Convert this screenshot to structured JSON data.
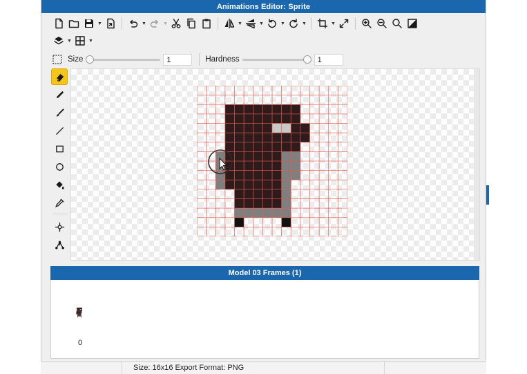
{
  "window": {
    "title": "Animations Editor: Sprite"
  },
  "toolbar": {
    "row1": [
      {
        "name": "new-file-icon",
        "arrow": false
      },
      {
        "name": "open-folder-icon",
        "arrow": false
      },
      {
        "name": "save-icon",
        "arrow": true
      },
      {
        "name": "export-icon",
        "arrow": false
      },
      {
        "sep": true
      },
      {
        "name": "undo-icon",
        "arrow": true
      },
      {
        "name": "redo-icon",
        "arrow": true,
        "disabled": true
      },
      {
        "name": "cut-icon",
        "arrow": false
      },
      {
        "name": "copy-icon",
        "arrow": false
      },
      {
        "name": "paste-icon",
        "arrow": false
      },
      {
        "sep": true
      },
      {
        "name": "flip-horizontal-icon",
        "arrow": true
      },
      {
        "name": "flip-vertical-icon",
        "arrow": true
      },
      {
        "name": "rotate-left-icon",
        "arrow": true
      },
      {
        "name": "rotate-right-icon",
        "arrow": true
      },
      {
        "sep": true
      },
      {
        "name": "crop-icon",
        "arrow": true
      },
      {
        "name": "resize-icon",
        "arrow": false
      },
      {
        "sep": true
      },
      {
        "name": "zoom-in-icon",
        "arrow": false
      },
      {
        "name": "zoom-out-icon",
        "arrow": false
      },
      {
        "name": "zoom-fit-icon",
        "arrow": false
      },
      {
        "name": "color-swap-icon",
        "arrow": false
      }
    ],
    "row2": [
      {
        "name": "layers-icon",
        "arrow": true
      },
      {
        "name": "grid-icon",
        "arrow": true
      }
    ]
  },
  "brush": {
    "selection_icon": "selection-icon",
    "size_label": "Size",
    "size_value": "1",
    "size_level": 0,
    "hardness_label": "Hardness",
    "hardness_value": "1",
    "hardness_level": 1
  },
  "tools": [
    {
      "name": "eraser-tool",
      "icon": "eraser-icon",
      "active": true
    },
    {
      "name": "pencil-tool",
      "icon": "pencil-icon"
    },
    {
      "name": "brush-tool",
      "icon": "brush-icon"
    },
    {
      "name": "line-tool",
      "icon": "line-icon"
    },
    {
      "name": "rectangle-tool",
      "icon": "rectangle-icon"
    },
    {
      "name": "ellipse-tool",
      "icon": "ellipse-icon"
    },
    {
      "name": "fill-tool",
      "icon": "paint-bucket-icon"
    },
    {
      "name": "eyedropper-tool",
      "icon": "eyedropper-icon"
    },
    {
      "sep": true
    },
    {
      "name": "move-pivot-tool",
      "icon": "pivot-icon"
    },
    {
      "name": "nodes-tool",
      "icon": "nodes-icon"
    }
  ],
  "sprite": {
    "grid_size": 16,
    "colors": {
      "D": "#2f1b1b",
      "G": "#7f7f7f",
      "L": "#c8c8c8",
      "K": "#111111",
      "grid": "#e8584a"
    },
    "rows": [
      "................",
      "................",
      "...DDDDDDDD.....",
      "...DDDDDDDD.....",
      "...DDDDDLLDD....",
      "...DDDDDDDDD....",
      "...DDDDDDDD.....",
      "..GDDDDDDGG.....",
      "..GDDDDDDGG.....",
      "..GDDDDDDGG.....",
      "..GDDDDDDG......",
      "....DDDDDG......",
      "....DDDDDG......",
      "....GGGGGG......",
      "....K....K......",
      "................"
    ]
  },
  "frames": {
    "header": "Model 03 Frames (1)",
    "items": [
      {
        "index": "0"
      }
    ]
  },
  "status": {
    "text": "Size: 16x16  Export Format: PNG"
  }
}
